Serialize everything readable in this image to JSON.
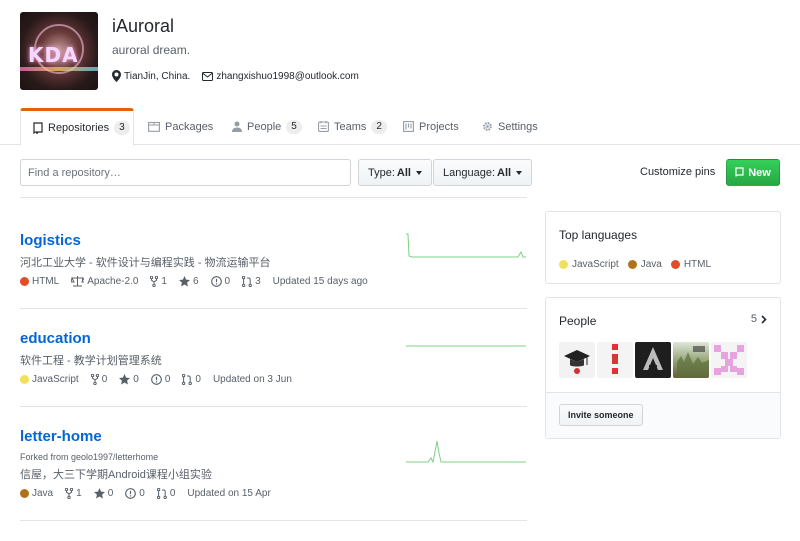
{
  "org": {
    "name": "iAuroral",
    "description": "auroral dream.",
    "location": "TianJin, China.",
    "email": "zhangxishuo1998@outlook.com",
    "avatar_text": "KDA"
  },
  "tabs": [
    {
      "label": "Repositories",
      "count": "3",
      "icon": "repo-icon"
    },
    {
      "label": "Packages",
      "count": "",
      "icon": "package-icon"
    },
    {
      "label": "People",
      "count": "5",
      "icon": "person-icon"
    },
    {
      "label": "Teams",
      "count": "2",
      "icon": "teams-icon"
    },
    {
      "label": "Projects",
      "count": "",
      "icon": "project-icon"
    },
    {
      "label": "Settings",
      "count": "",
      "icon": "gear-icon"
    }
  ],
  "filters": {
    "search_placeholder": "Find a repository…",
    "type_label": "Type:",
    "type_value": "All",
    "language_label": "Language:",
    "language_value": "All",
    "customize_pins": "Customize pins",
    "new_button": "New"
  },
  "colors": {
    "link": "#0366d6",
    "green": "#28a745",
    "html": "#e34c26",
    "javascript": "#f1e05a",
    "java": "#b07219",
    "spark": "#7dd085"
  },
  "repos": [
    {
      "name": "logistics",
      "forked_from": "",
      "description": "河北工业大学 - 软件设计与编程实践 - 物流运输平台",
      "language": "HTML",
      "language_color": "#e34c26",
      "license": "Apache-2.0",
      "forks": "1",
      "stars": "6",
      "issues": "0",
      "pull_requests": "3",
      "updated": "Updated 15 days ago"
    },
    {
      "name": "education",
      "forked_from": "",
      "description": "软件工程 - 教学计划管理系统",
      "language": "JavaScript",
      "language_color": "#f1e05a",
      "license": "",
      "forks": "0",
      "stars": "0",
      "issues": "0",
      "pull_requests": "0",
      "updated": "Updated on 3 Jun"
    },
    {
      "name": "letter-home",
      "forked_from": "Forked from geolo1997/letterhome",
      "description": "信屋，大三下学期Android课程小组实验",
      "language": "Java",
      "language_color": "#b07219",
      "license": "",
      "forks": "1",
      "stars": "0",
      "issues": "0",
      "pull_requests": "0",
      "updated": "Updated on 15 Apr"
    }
  ],
  "top_languages": {
    "title": "Top languages",
    "items": [
      {
        "name": "JavaScript",
        "color": "#f1e05a"
      },
      {
        "name": "Java",
        "color": "#b07219"
      },
      {
        "name": "HTML",
        "color": "#e34c26"
      }
    ]
  },
  "people": {
    "title": "People",
    "count": "5",
    "invite_label": "Invite someone"
  }
}
